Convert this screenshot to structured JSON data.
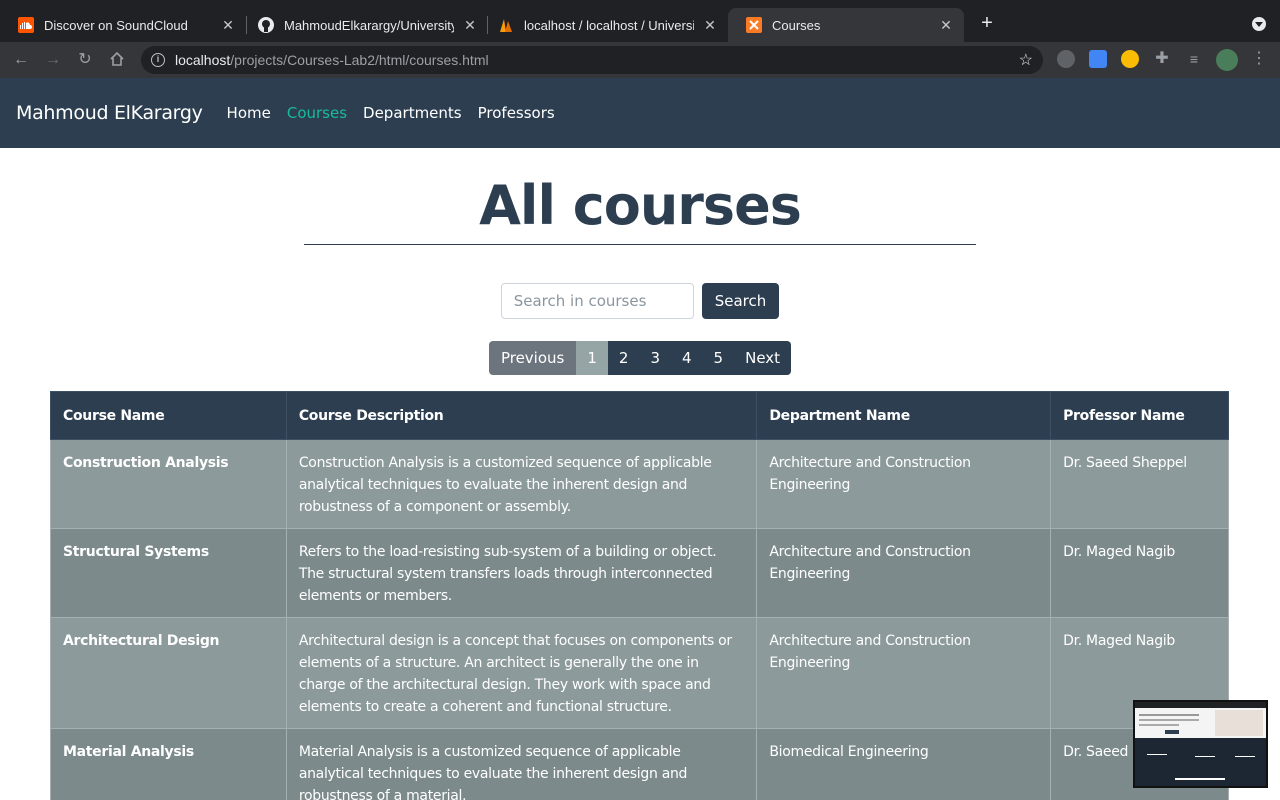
{
  "browser": {
    "tabs": [
      {
        "title": "Discover on SoundCloud",
        "icon": "soundcloud-icon"
      },
      {
        "title": "MahmoudElkarargy/University-",
        "icon": "github-icon"
      },
      {
        "title": "localhost / localhost / Universit",
        "icon": "phpmyadmin-icon"
      },
      {
        "title": "Courses",
        "icon": "xampp-icon"
      }
    ],
    "url_host": "localhost",
    "url_path": "/projects/Courses-Lab2/html/courses.html"
  },
  "nav": {
    "brand": "Mahmoud ElKarargy",
    "links": [
      "Home",
      "Courses",
      "Departments",
      "Professors"
    ],
    "active": "Courses",
    "accent_color": "#18bc9c",
    "bg_color": "#2c3e50"
  },
  "page": {
    "title": "All courses"
  },
  "search": {
    "placeholder": "Search in courses",
    "button_label": "Search"
  },
  "pagination": {
    "previous": "Previous",
    "pages": [
      "1",
      "2",
      "3",
      "4",
      "5"
    ],
    "current": "1",
    "next": "Next"
  },
  "table": {
    "headers": [
      "Course Name",
      "Course Description",
      "Department Name",
      "Professor Name"
    ],
    "rows": [
      {
        "name": "Construction Analysis",
        "description": "Construction Analysis is a customized sequence of applicable analytical techniques to evaluate the inherent design and robustness of a component or assembly.",
        "department": "Architecture and Construction Engineering",
        "professor": "Dr. Saeed Sheppel"
      },
      {
        "name": "Structural Systems",
        "description": "Refers to the load-resisting sub-system of a building or object. The structural system transfers loads through interconnected elements or members.",
        "department": "Architecture and Construction Engineering",
        "professor": "Dr. Maged Nagib"
      },
      {
        "name": "Architectural Design",
        "description": "Architectural design is a concept that focuses on components or elements of a structure. An architect is generally the one in charge of the architectural design. They work with space and elements to create a coherent and functional structure.",
        "department": "Architecture and Construction Engineering",
        "professor": "Dr. Maged Nagib"
      },
      {
        "name": "Material Analysis",
        "description": "Material Analysis is a customized sequence of applicable analytical techniques to evaluate the inherent design and robustness of a material.",
        "department": "Biomedical Engineering",
        "professor": "Dr. Saeed Sheppel"
      }
    ]
  }
}
